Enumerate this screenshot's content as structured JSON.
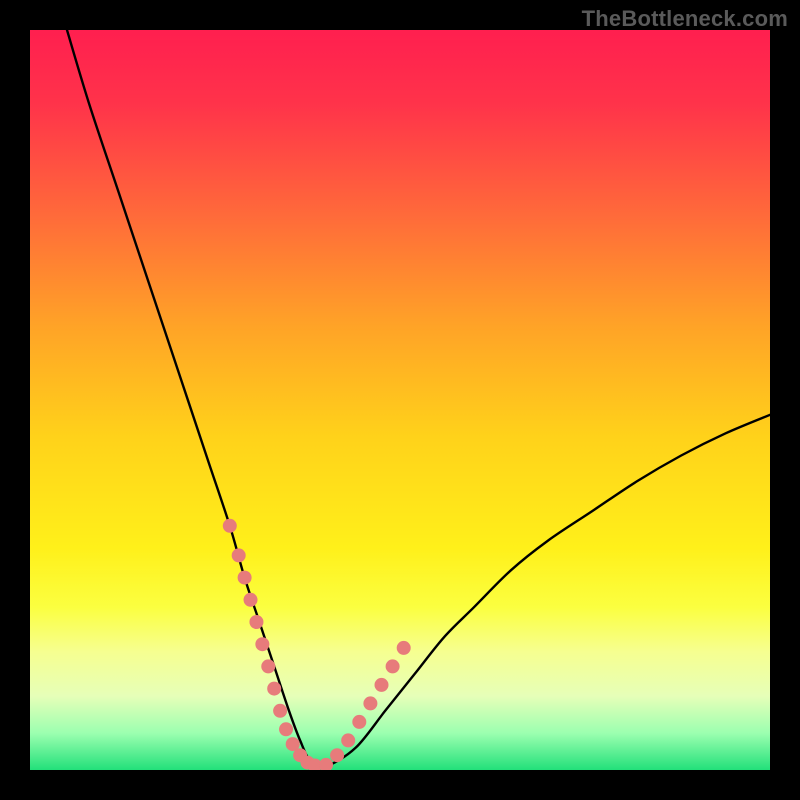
{
  "watermark": "TheBottleneck.com",
  "colors": {
    "background": "#000000",
    "gradient_stops": [
      {
        "offset": 0.0,
        "color": "#ff1f4f"
      },
      {
        "offset": 0.1,
        "color": "#ff334a"
      },
      {
        "offset": 0.25,
        "color": "#ff6a3a"
      },
      {
        "offset": 0.4,
        "color": "#ffa327"
      },
      {
        "offset": 0.55,
        "color": "#ffd21a"
      },
      {
        "offset": 0.7,
        "color": "#fff01a"
      },
      {
        "offset": 0.78,
        "color": "#fbff40"
      },
      {
        "offset": 0.84,
        "color": "#f6ff90"
      },
      {
        "offset": 0.9,
        "color": "#e6ffb8"
      },
      {
        "offset": 0.95,
        "color": "#9cffb0"
      },
      {
        "offset": 1.0,
        "color": "#22e07a"
      }
    ],
    "curve": "#000000",
    "marker_fill": "#e77b7b",
    "marker_stroke": "#d96a6a"
  },
  "chart_data": {
    "type": "line",
    "title": "",
    "xlabel": "",
    "ylabel": "",
    "xlim": [
      0,
      100
    ],
    "ylim": [
      0,
      100
    ],
    "series": [
      {
        "name": "bottleneck-curve",
        "x": [
          5,
          8,
          12,
          16,
          20,
          24,
          27,
          29,
          31,
          33,
          35,
          36.5,
          38,
          40,
          44,
          48,
          52,
          56,
          60,
          65,
          70,
          76,
          82,
          88,
          94,
          100
        ],
        "y": [
          100,
          90,
          78,
          66,
          54,
          42,
          33,
          26,
          20,
          14,
          8,
          4,
          1,
          0.5,
          3,
          8,
          13,
          18,
          22,
          27,
          31,
          35,
          39,
          42.5,
          45.5,
          48
        ]
      }
    ],
    "markers": {
      "name": "highlight-dots",
      "x": [
        27.0,
        28.2,
        29.0,
        29.8,
        30.6,
        31.4,
        32.2,
        33.0,
        33.8,
        34.6,
        35.5,
        36.5,
        37.5,
        38.5,
        40.0,
        41.5,
        43.0,
        44.5,
        46.0,
        47.5,
        49.0,
        50.5
      ],
      "y": [
        33.0,
        29.0,
        26.0,
        23.0,
        20.0,
        17.0,
        14.0,
        11.0,
        8.0,
        5.5,
        3.5,
        2.0,
        1.0,
        0.6,
        0.7,
        2.0,
        4.0,
        6.5,
        9.0,
        11.5,
        14.0,
        16.5
      ]
    }
  }
}
